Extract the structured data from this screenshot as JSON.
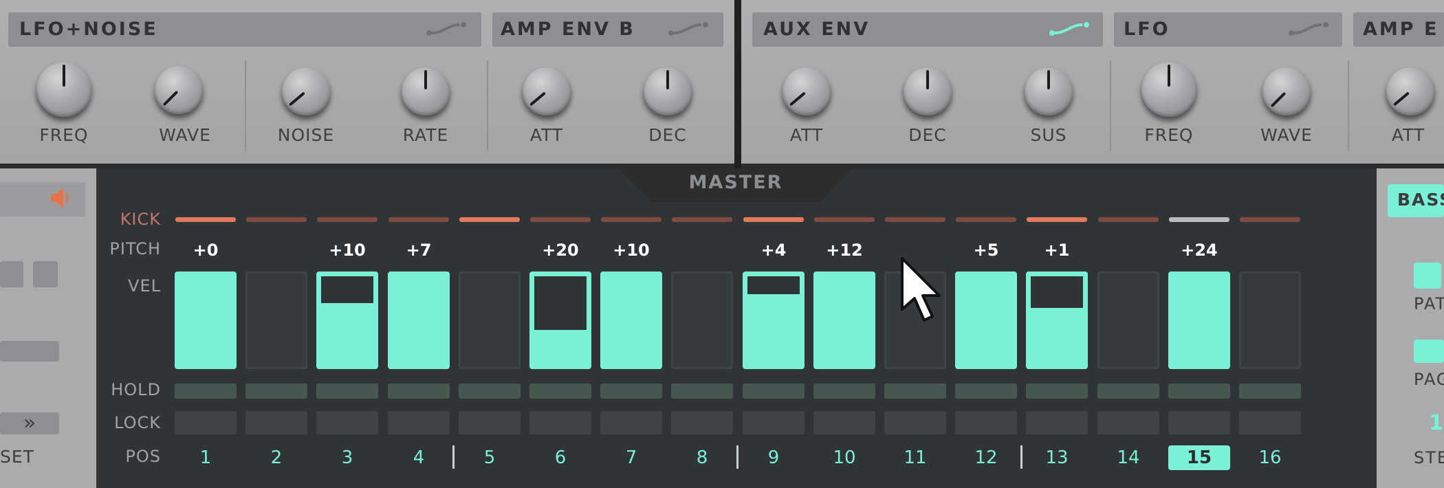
{
  "panels": {
    "lfo_noise": {
      "title": "LFO+NOISE",
      "knobs": [
        "FREQ",
        "WAVE",
        "NOISE",
        "RATE"
      ]
    },
    "amp_env_b": {
      "title": "AMP ENV B",
      "knobs": [
        "ATT",
        "DEC"
      ]
    },
    "aux_env": {
      "title": "AUX ENV",
      "knobs": [
        "ATT",
        "DEC",
        "SUS"
      ]
    },
    "lfo": {
      "title": "LFO",
      "knobs": [
        "FREQ",
        "WAVE"
      ]
    },
    "amp_env_partial": {
      "title": "AMP E",
      "knobs": [
        "ATT"
      ]
    }
  },
  "icons": {
    "envelope_icon": "envelope-curve-icon",
    "speaker": "speaker-icon",
    "forward": "double-chevron-right-icon",
    "cursor": "mouse-pointer-icon"
  },
  "master": {
    "label": "MASTER"
  },
  "row_labels": {
    "kick": "KICK",
    "pitch": "PITCH",
    "vel": "VEL",
    "hold": "HOLD",
    "lock": "LOCK",
    "pos": "POS"
  },
  "steps": [
    {
      "pos": "1",
      "pitch": "+0",
      "vel_on": true,
      "vel_level": 1.0,
      "kick": "on"
    },
    {
      "pos": "2",
      "pitch": "",
      "vel_on": false,
      "vel_level": 0,
      "kick": "off"
    },
    {
      "pos": "3",
      "pitch": "+10",
      "vel_on": true,
      "vel_level": 0.7,
      "kick": "off"
    },
    {
      "pos": "4",
      "pitch": "+7",
      "vel_on": true,
      "vel_level": 1.0,
      "kick": "off"
    },
    {
      "pos": "5",
      "pitch": "",
      "vel_on": false,
      "vel_level": 0,
      "kick": "on"
    },
    {
      "pos": "6",
      "pitch": "+20",
      "vel_on": true,
      "vel_level": 0.4,
      "kick": "off"
    },
    {
      "pos": "7",
      "pitch": "+10",
      "vel_on": true,
      "vel_level": 1.0,
      "kick": "off"
    },
    {
      "pos": "8",
      "pitch": "",
      "vel_on": false,
      "vel_level": 0,
      "kick": "off"
    },
    {
      "pos": "9",
      "pitch": "+4",
      "vel_on": true,
      "vel_level": 0.8,
      "kick": "on"
    },
    {
      "pos": "10",
      "pitch": "+12",
      "vel_on": true,
      "vel_level": 1.0,
      "kick": "off"
    },
    {
      "pos": "11",
      "pitch": "",
      "vel_on": false,
      "vel_level": 0,
      "kick": "off"
    },
    {
      "pos": "12",
      "pitch": "+5",
      "vel_on": true,
      "vel_level": 1.0,
      "kick": "off"
    },
    {
      "pos": "13",
      "pitch": "+1",
      "vel_on": true,
      "vel_level": 0.65,
      "kick": "on"
    },
    {
      "pos": "14",
      "pitch": "",
      "vel_on": false,
      "vel_level": 0,
      "kick": "off"
    },
    {
      "pos": "15",
      "pitch": "+24",
      "vel_on": true,
      "vel_level": 1.0,
      "kick": "playhead"
    },
    {
      "pos": "16",
      "pitch": "",
      "vel_on": false,
      "vel_level": 0,
      "kick": "off"
    }
  ],
  "active_pos": "15",
  "left_strip": {
    "preset_label": "SET",
    "forward_label": "»"
  },
  "right_strip": {
    "bass_label": "BASS",
    "pat_label": "PAT",
    "page_label": "PAG",
    "step_label": "STE",
    "step_value": "1"
  },
  "colors": {
    "accent": "#7af0d6",
    "kick_on": "#e07a5a",
    "kick_off": "#7d4b42",
    "kick_playhead": "#b8bdbf",
    "speaker": "#e8714e"
  }
}
